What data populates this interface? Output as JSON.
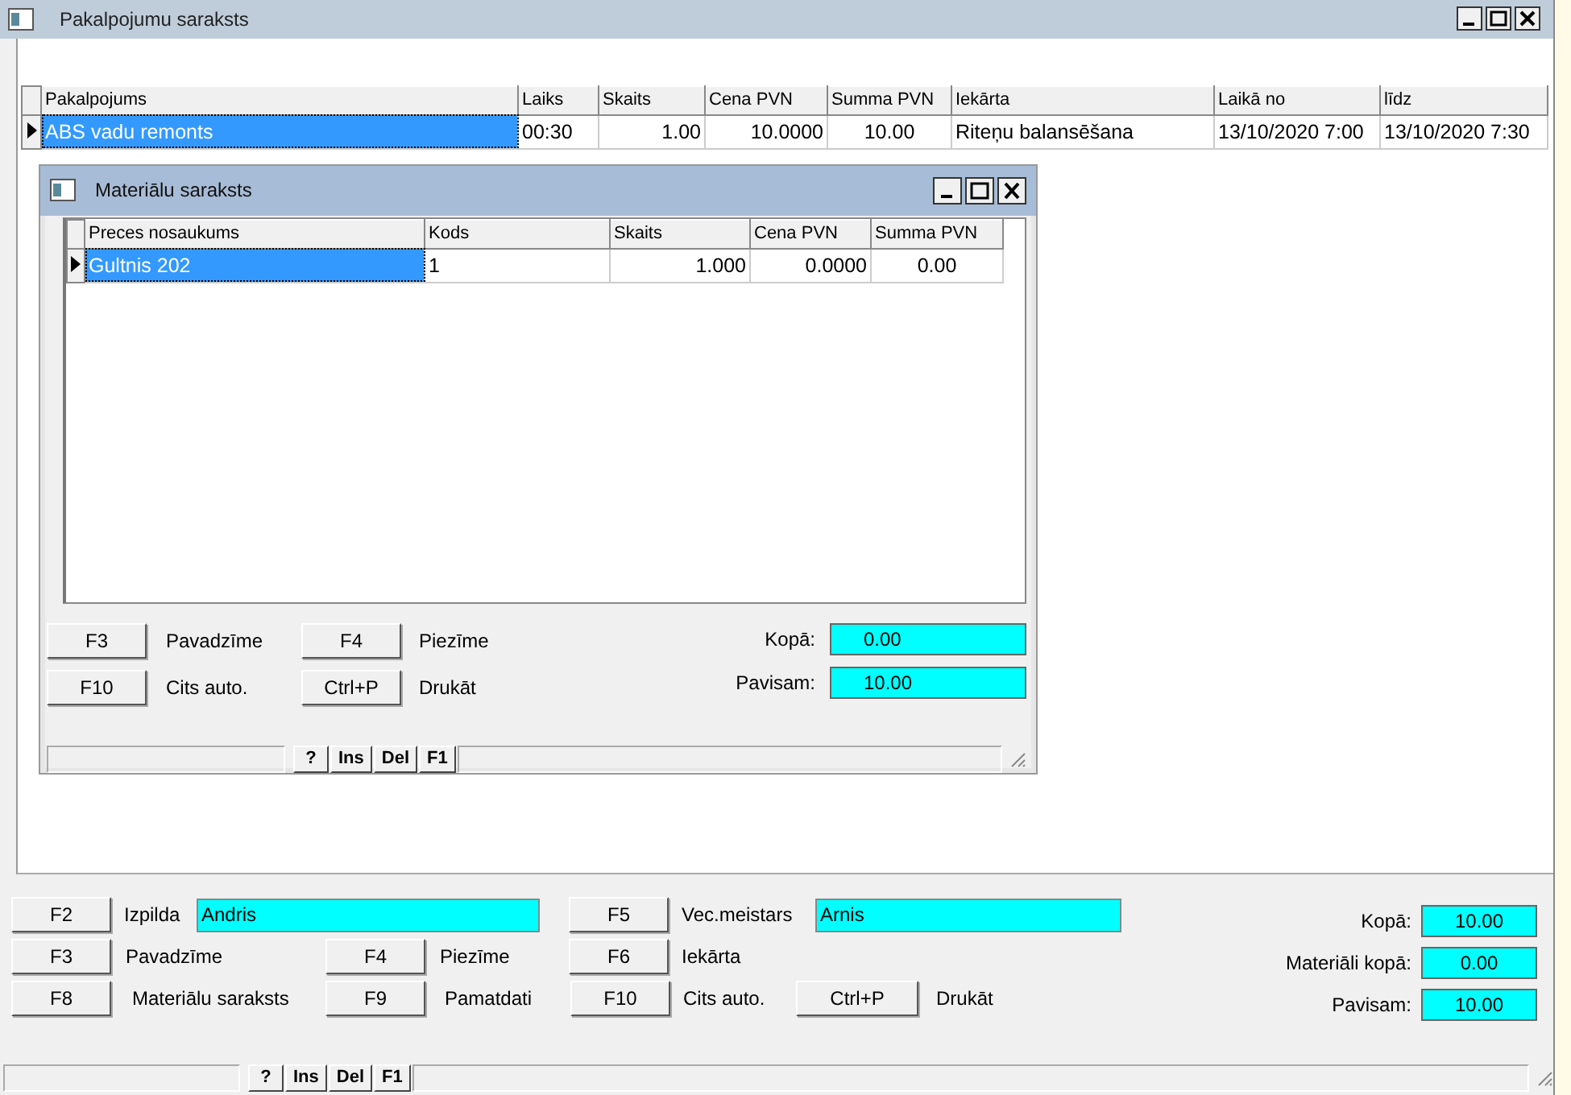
{
  "window": {
    "title": "Pakalpojumu saraksts"
  },
  "services": {
    "columns": [
      "Pakalpojums",
      "Laiks",
      "Skaits",
      "Cena PVN",
      "Summa PVN",
      "Iekārta",
      "Laikā no",
      "līdz"
    ],
    "rows": [
      {
        "selected": true,
        "cells": [
          "ABS vadu remonts",
          "00:30",
          "1.00",
          "10.0000",
          "10.00",
          "Riteņu balansēšana",
          "13/10/2020  7:00",
          "13/10/2020  7:30"
        ]
      }
    ]
  },
  "materials_window": {
    "title": "Materiālu saraksts",
    "columns": [
      "Preces nosaukums",
      "Kods",
      "Skaits",
      "Cena PVN",
      "Summa PVN"
    ],
    "rows": [
      {
        "selected": true,
        "cells": [
          "Gultnis 202",
          "1",
          "1.000",
          "0.0000",
          "0.00"
        ]
      }
    ],
    "actions": [
      [
        {
          "key": "F3",
          "label": "Pavadzīme"
        },
        {
          "key": "F4",
          "label": "Piezīme"
        }
      ],
      [
        {
          "key": "F10",
          "label": "Cits auto."
        },
        {
          "key": "Ctrl+P",
          "label": "Drukāt"
        }
      ]
    ],
    "totals": [
      {
        "label": "Kopā:",
        "value": "0.00"
      },
      {
        "label": "Pavisam:",
        "value": "10.00"
      }
    ],
    "status_keys": [
      "?",
      "Ins",
      "Del",
      "F1"
    ]
  },
  "footer": {
    "rows": [
      [
        {
          "kind": "button",
          "text": "F2"
        },
        {
          "kind": "label",
          "text": "Izpilda"
        },
        {
          "kind": "field",
          "text": "Andris"
        },
        {
          "kind": "gap"
        },
        {
          "kind": "button",
          "text": "F5"
        },
        {
          "kind": "label",
          "text": "Vec.meistars"
        },
        {
          "kind": "field",
          "text": "Arnis"
        }
      ],
      [
        {
          "kind": "button",
          "text": "F3"
        },
        {
          "kind": "label",
          "text": "Pavadzīme"
        },
        {
          "kind": "button",
          "text": "F4"
        },
        {
          "kind": "label",
          "text": "Piezīme"
        },
        {
          "kind": "button",
          "text": "F6"
        },
        {
          "kind": "label",
          "text": "Iekārta"
        }
      ],
      [
        {
          "kind": "button",
          "text": "F8"
        },
        {
          "kind": "label",
          "text": "Materiālu saraksts"
        },
        {
          "kind": "button",
          "text": "F9"
        },
        {
          "kind": "label",
          "text": "Pamatdati"
        },
        {
          "kind": "button",
          "text": "F10"
        },
        {
          "kind": "label",
          "text": "Cits auto."
        },
        {
          "kind": "button",
          "text": "Ctrl+P"
        },
        {
          "kind": "label",
          "text": "Drukāt"
        }
      ]
    ],
    "totals": [
      {
        "label": "Kopā:",
        "value": "10.00"
      },
      {
        "label": "Materiāli kopā:",
        "value": "0.00"
      },
      {
        "label": "Pavisam:",
        "value": "10.00"
      }
    ]
  },
  "status_keys": [
    "?",
    "Ins",
    "Del",
    "F1"
  ]
}
